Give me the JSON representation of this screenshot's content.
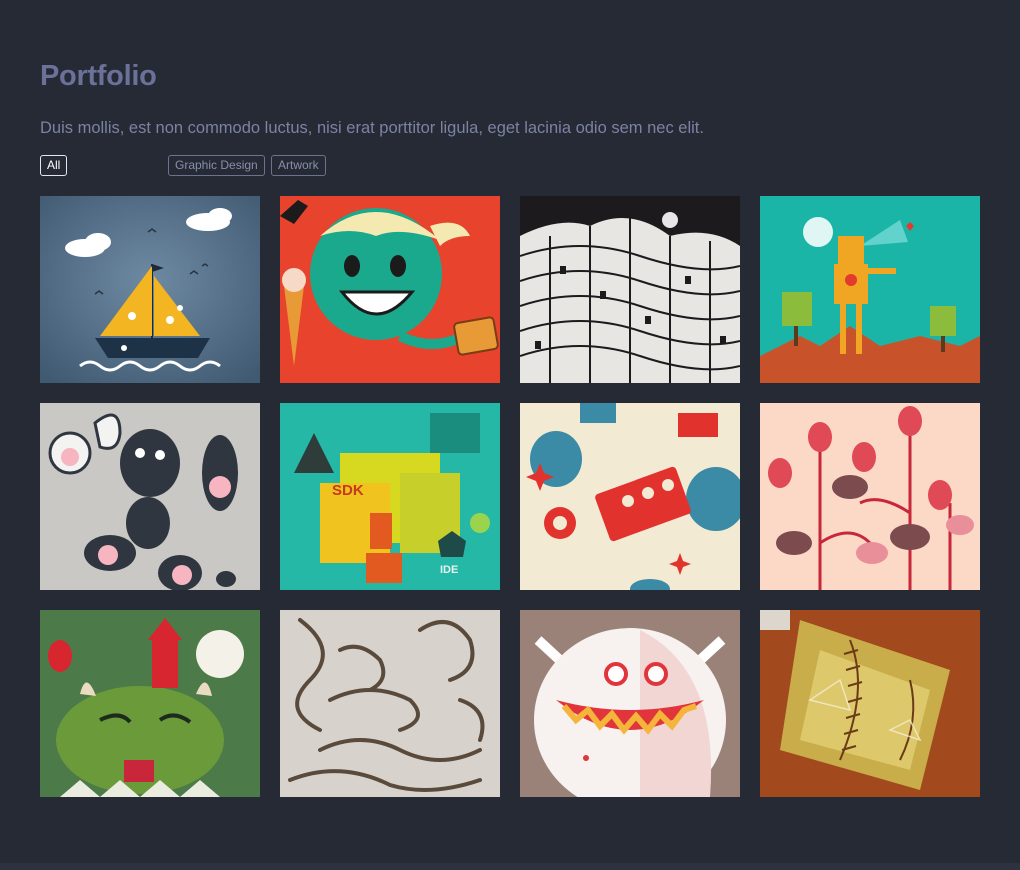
{
  "page": {
    "title": "Portfolio",
    "subtitle": "Duis mollis, est non commodo luctus, nisi erat porttitor ligula, eget lacinia odio sem nec elit."
  },
  "filters": [
    {
      "label": "All",
      "active": true
    },
    {
      "label": "Graphic Design",
      "active": false
    },
    {
      "label": "Artwork",
      "active": false
    }
  ],
  "tiles": [
    {
      "name": "sailboat-artwork",
      "bg": "#4a6a85"
    },
    {
      "name": "ice-cream-kid-artwork",
      "bg": "#e8432c"
    },
    {
      "name": "ink-city-artwork",
      "bg": "#1c1a1d"
    },
    {
      "name": "robot-desert-artwork",
      "bg": "#1bb5a8"
    },
    {
      "name": "doodle-monsters-artwork",
      "bg": "#c9c8c5"
    },
    {
      "name": "sdk-ide-artwork",
      "bg": "#26b8a6"
    },
    {
      "name": "retro-robots-artwork",
      "bg": "#f2ead3"
    },
    {
      "name": "hens-eggs-artwork",
      "bg": "#fbd9c6"
    },
    {
      "name": "green-monster-castle-artwork",
      "bg": "#4c7a48"
    },
    {
      "name": "ribbon-lettering-artwork",
      "bg": "#d7d3cc"
    },
    {
      "name": "white-monster-grin-artwork",
      "bg": "#9a8278"
    },
    {
      "name": "stitched-leather-artwork",
      "bg": "#a24a1e"
    }
  ],
  "colors": {
    "background": "#262a35",
    "title": "#6b7199",
    "subtitle": "#7c82a2",
    "filter_border": "#6d7290"
  }
}
